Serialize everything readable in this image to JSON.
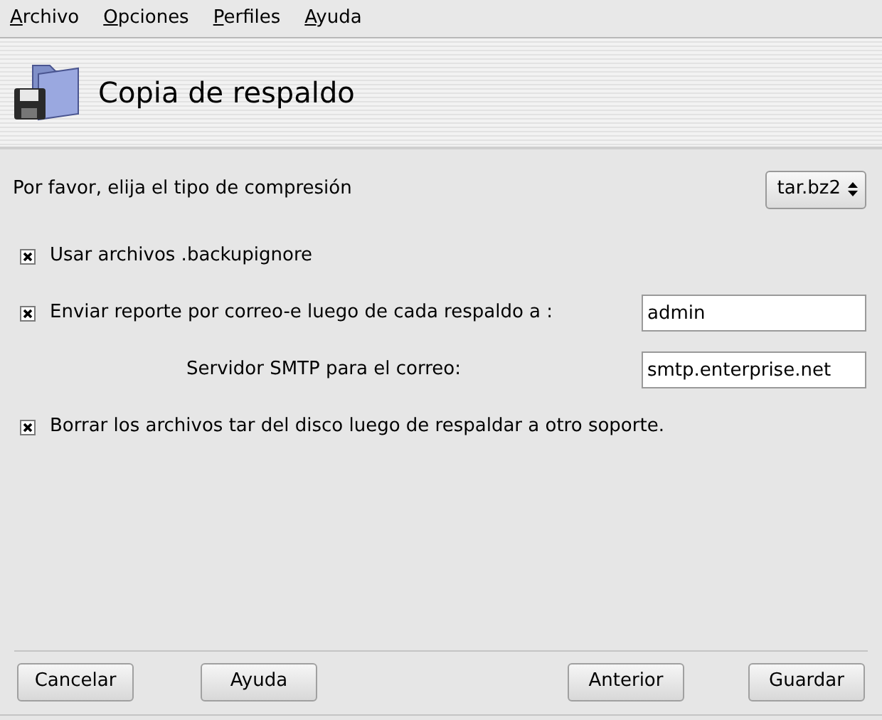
{
  "menu": [
    "Archivo",
    "Opciones",
    "Perfiles",
    "Ayuda"
  ],
  "header": {
    "title": "Copia de respaldo"
  },
  "compression": {
    "label": "Por favor, elija el tipo de compresión",
    "value": "tar.bz2"
  },
  "options": [
    {
      "kind": "checkbox",
      "label": "Usar archivos .backupignore",
      "checked": true
    },
    {
      "kind": "checkbox-field",
      "label": "Enviar reporte por correo-e luego de cada respaldo a :",
      "checked": true,
      "value": "admin"
    },
    {
      "kind": "field",
      "label": "Servidor SMTP para el correo:",
      "value": "smtp.enterprise.net"
    },
    {
      "kind": "checkbox",
      "label": "Borrar los archivos tar del disco luego de respaldar a otro soporte.",
      "checked": true
    }
  ],
  "buttons": [
    "Cancelar",
    "Ayuda",
    "Anterior",
    "Guardar"
  ]
}
